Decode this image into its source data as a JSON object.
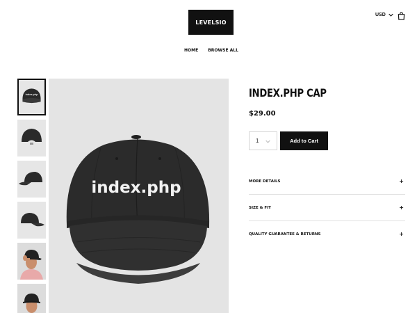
{
  "header": {
    "logo_text": "LEVELSIO",
    "currency": "USD",
    "cart_icon": "shopping-bag-icon"
  },
  "nav": {
    "items": [
      {
        "label": "HOME"
      },
      {
        "label": "BROWSE ALL"
      }
    ]
  },
  "gallery": {
    "main_image_text": "index.php",
    "thumbnails": [
      {
        "name": "thumb-front",
        "active": true,
        "cap_text": "index.php"
      },
      {
        "name": "thumb-back",
        "active": false
      },
      {
        "name": "thumb-side",
        "active": false
      },
      {
        "name": "thumb-side-left",
        "active": false
      },
      {
        "name": "thumb-model-1",
        "active": false
      },
      {
        "name": "thumb-model-2",
        "active": false
      }
    ]
  },
  "product": {
    "title": "INDEX.PHP CAP",
    "price": "$29.00",
    "quantity": "1",
    "add_to_cart_label": "Add to Cart"
  },
  "accordion": [
    {
      "label": "MORE DETAILS",
      "icon": "+"
    },
    {
      "label": "SIZE & FIT",
      "icon": "+"
    },
    {
      "label": "QUALITY GUARANTEE & RETURNS",
      "icon": "+"
    }
  ],
  "colors": {
    "primary": "#111111",
    "background": "#ffffff",
    "image_bg": "#e4e4e4",
    "divider": "#e2e2e2"
  }
}
